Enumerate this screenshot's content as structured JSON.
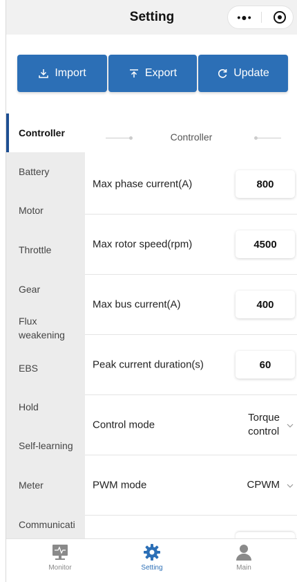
{
  "header": {
    "title": "Setting",
    "more_icon": "more-dots-icon",
    "close_icon": "target-icon"
  },
  "actions": {
    "import": {
      "label": "Import",
      "icon": "download-icon"
    },
    "export": {
      "label": "Export",
      "icon": "upload-icon"
    },
    "update": {
      "label": "Update",
      "icon": "refresh-icon"
    },
    "color": "#2c6fb6"
  },
  "sidebar": {
    "items": [
      {
        "label": "Controller",
        "active": true
      },
      {
        "label": "Battery"
      },
      {
        "label": "Motor"
      },
      {
        "label": "Throttle"
      },
      {
        "label": "Gear"
      },
      {
        "label": "Flux weakening"
      },
      {
        "label": "EBS"
      },
      {
        "label": "Hold"
      },
      {
        "label": "Self-learning"
      },
      {
        "label": "Meter"
      },
      {
        "label": "Communicati"
      }
    ]
  },
  "section": {
    "title": "Controller"
  },
  "params": [
    {
      "label": "Max phase current(A)",
      "value": "800"
    },
    {
      "label": "Max rotor speed(rpm)",
      "value": "4500"
    },
    {
      "label": "Max bus current(A)",
      "value": "400"
    },
    {
      "label": "Peak current duration(s)",
      "value": "60"
    },
    {
      "label": "Control mode",
      "value": "Torque control"
    },
    {
      "label": "PWM mode",
      "value": "CPWM"
    }
  ],
  "control_mode_lines": [
    "Torque",
    "control"
  ],
  "tabbar": {
    "tabs": [
      {
        "label": "Monitor",
        "icon": "monitor-icon"
      },
      {
        "label": "Setting",
        "icon": "gear-icon",
        "active": true
      },
      {
        "label": "Main",
        "icon": "user-icon"
      }
    ]
  }
}
